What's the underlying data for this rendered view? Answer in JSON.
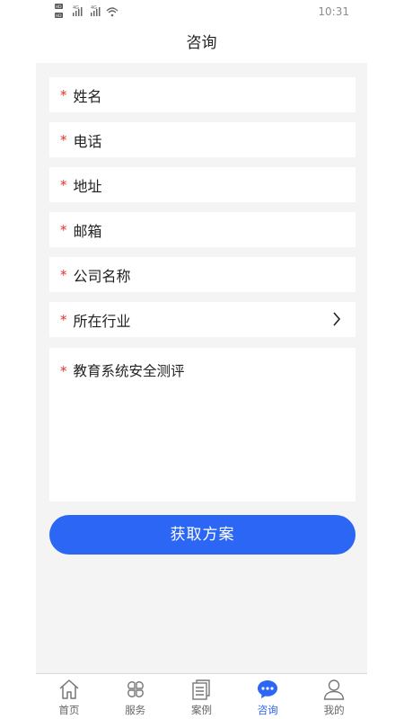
{
  "status_bar": {
    "time": "10:31",
    "indicators": [
      "HD",
      "HD",
      "4G",
      "4G",
      "wifi"
    ]
  },
  "header": {
    "title": "咨询"
  },
  "form": {
    "required_mark": "*",
    "fields": [
      {
        "label": "姓名"
      },
      {
        "label": "电话"
      },
      {
        "label": "地址"
      },
      {
        "label": "邮箱"
      },
      {
        "label": "公司名称"
      },
      {
        "label": "所在行业"
      }
    ],
    "textarea_label": "教育系统安全测评",
    "submit_label": "获取方案"
  },
  "tabs": [
    {
      "label": "首页",
      "icon": "home-icon",
      "active": false
    },
    {
      "label": "服务",
      "icon": "grid-icon",
      "active": false
    },
    {
      "label": "案例",
      "icon": "documents-icon",
      "active": false
    },
    {
      "label": "咨询",
      "icon": "chat-icon",
      "active": true
    },
    {
      "label": "我的",
      "icon": "user-icon",
      "active": false
    }
  ],
  "colors": {
    "accent": "#2c66f5",
    "required": "#e5312b",
    "background": "#f4f4f4"
  }
}
